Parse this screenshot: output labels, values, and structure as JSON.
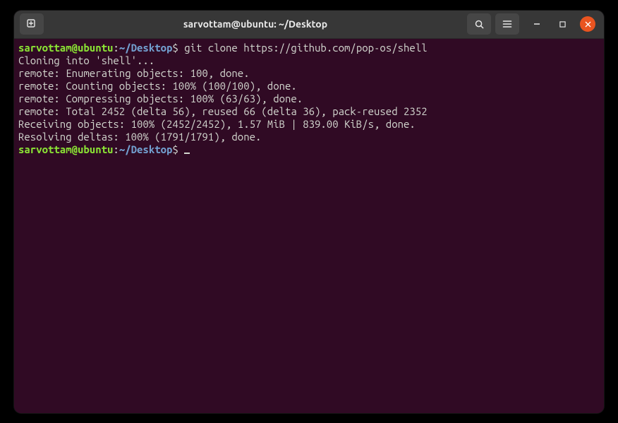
{
  "window": {
    "title": "sarvottam@ubuntu: ~/Desktop"
  },
  "prompt": {
    "user_host": "sarvottam@ubuntu",
    "sep": ":",
    "path": "~/Desktop",
    "symbol": "$"
  },
  "lines": {
    "cmd1": "git clone https://github.com/pop-os/shell",
    "out1": "Cloning into 'shell'...",
    "out2": "remote: Enumerating objects: 100, done.",
    "out3": "remote: Counting objects: 100% (100/100), done.",
    "out4": "remote: Compressing objects: 100% (63/63), done.",
    "out5": "remote: Total 2452 (delta 56), reused 66 (delta 36), pack-reused 2352",
    "out6": "Receiving objects: 100% (2452/2452), 1.57 MiB | 839.00 KiB/s, done.",
    "out7": "Resolving deltas: 100% (1791/1791), done."
  }
}
